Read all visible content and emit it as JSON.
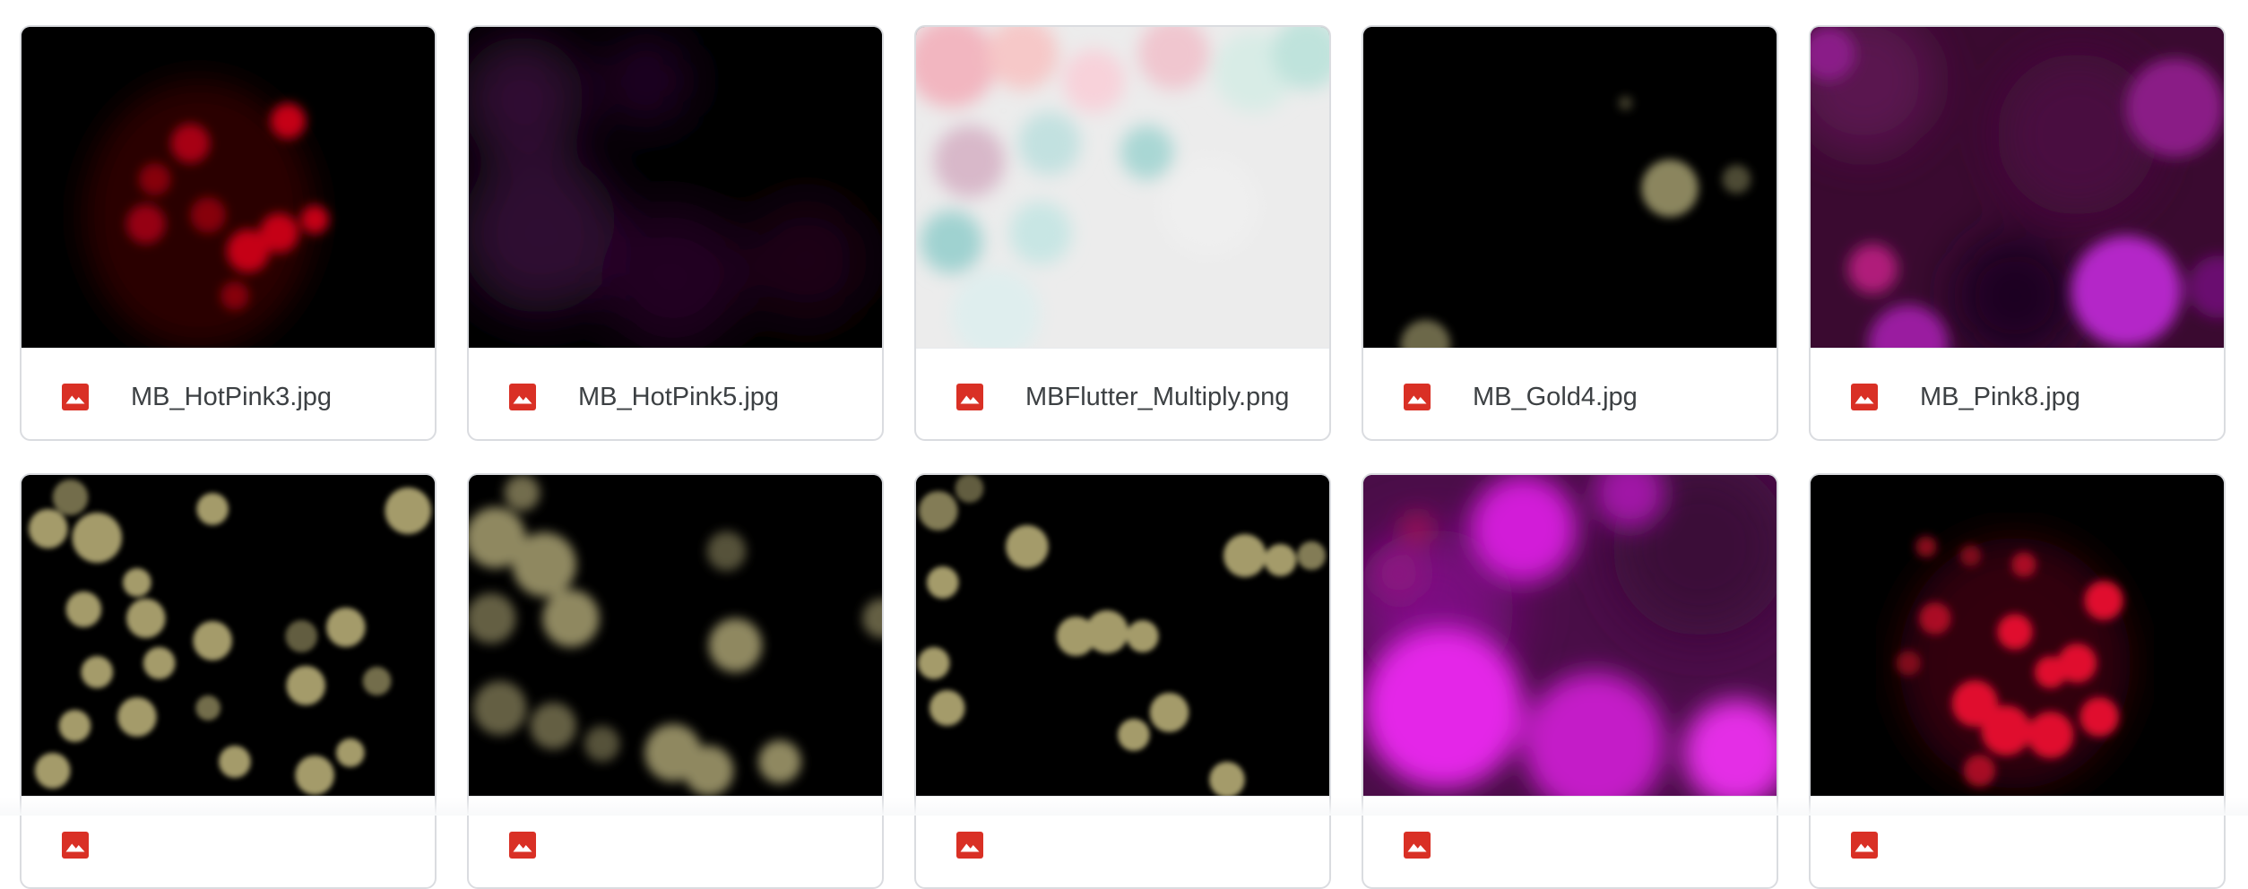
{
  "files": [
    {
      "name": "MB_HotPink3.jpg",
      "icon": "image-file-icon"
    },
    {
      "name": "MB_HotPink5.jpg",
      "icon": "image-file-icon"
    },
    {
      "name": "MBFlutter_Multiply.png",
      "icon": "image-file-icon"
    },
    {
      "name": "MB_Gold4.jpg",
      "icon": "image-file-icon"
    },
    {
      "name": "MB_Pink8.jpg",
      "icon": "image-file-icon"
    },
    {
      "name": "",
      "icon": "image-file-icon"
    },
    {
      "name": "",
      "icon": "image-file-icon"
    },
    {
      "name": "",
      "icon": "image-file-icon"
    },
    {
      "name": "",
      "icon": "image-file-icon"
    },
    {
      "name": "",
      "icon": "image-file-icon"
    }
  ],
  "colors": {
    "icon_red": "#d93025",
    "text": "#3c4043",
    "border": "#dadce0"
  }
}
